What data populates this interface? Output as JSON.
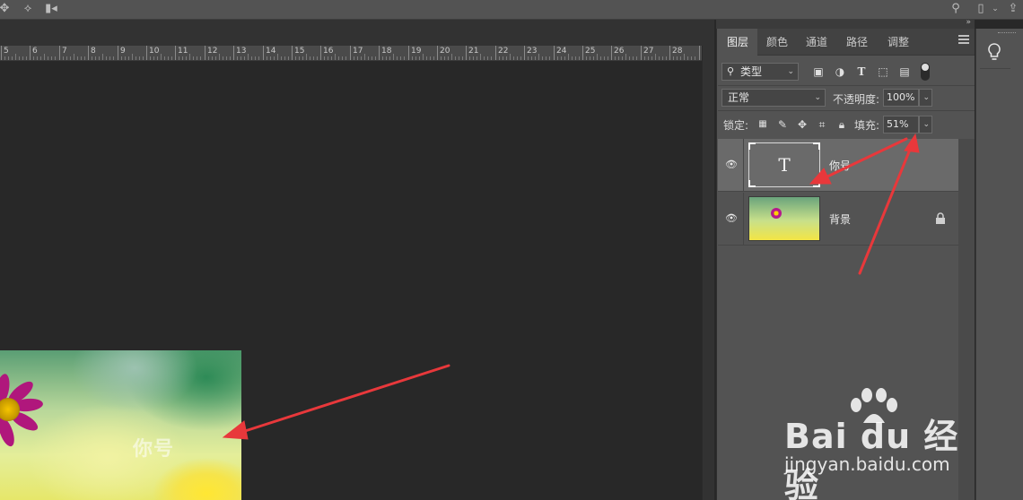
{
  "panel_tabs": [
    "图层",
    "颜色",
    "通道",
    "路径",
    "调整"
  ],
  "filter": {
    "kind_label": "类型"
  },
  "blend": {
    "mode": "正常",
    "opacity_label": "不透明度:",
    "opacity_value": "100%"
  },
  "lock": {
    "label": "锁定:",
    "fill_label": "填充:",
    "fill_value": "51%"
  },
  "layers": [
    {
      "name": "你号",
      "type": "text",
      "thumb_glyph": "T",
      "selected": true
    },
    {
      "name": "背景",
      "type": "image",
      "locked": true
    }
  ],
  "ruler_labels": [
    "5",
    "6",
    "7",
    "8",
    "9",
    "10",
    "11",
    "12",
    "13",
    "14",
    "15",
    "16",
    "17",
    "18",
    "19",
    "20",
    "21",
    "22",
    "23",
    "24",
    "25",
    "26",
    "27",
    "28",
    "29"
  ],
  "canvas_text": "你号",
  "watermark": {
    "logo": "Bai du 经验",
    "url": "jingyan.baidu.com"
  },
  "colors": {
    "annotation_arrow": "#e8383b",
    "panel_bg": "#535353",
    "workspace_bg": "#282828"
  },
  "icons": {
    "topbar": [
      "move-distribute-icon",
      "transform-3d-icon",
      "video-camera-icon",
      "search-icon",
      "window-layout-icon",
      "chevron-down-icon",
      "share-icon"
    ],
    "filter": [
      "image-filter-icon",
      "adjustment-filter-icon",
      "type-filter-icon",
      "shape-filter-icon",
      "smart-object-filter-icon",
      "filter-toggle-icon"
    ],
    "lock": [
      "lock-transparent-pixels-icon",
      "lock-image-pixels-icon",
      "lock-position-icon",
      "lock-artboard-icon",
      "lock-all-icon"
    ]
  }
}
